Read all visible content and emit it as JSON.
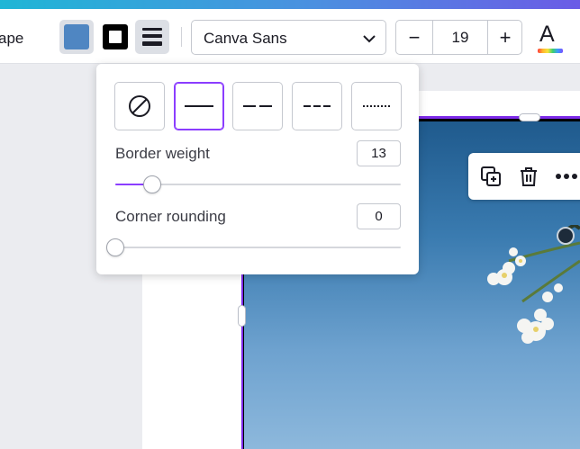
{
  "toolbar": {
    "shape_label": "ape",
    "font": "Canva Sans",
    "font_size": "19",
    "minus": "−",
    "plus": "+",
    "text_color_letter": "A"
  },
  "popover": {
    "border_weight_label": "Border weight",
    "border_weight_value": "13",
    "border_weight_fraction": 0.13,
    "corner_rounding_label": "Corner rounding",
    "corner_rounding_value": "0",
    "corner_rounding_fraction": 0,
    "styles": [
      "none",
      "solid",
      "long-dash",
      "short-dash",
      "dotted"
    ],
    "selected_style": "solid"
  },
  "colors": {
    "accent": "#8b3dff",
    "fill": "#4f86c2",
    "border": "#000000"
  }
}
